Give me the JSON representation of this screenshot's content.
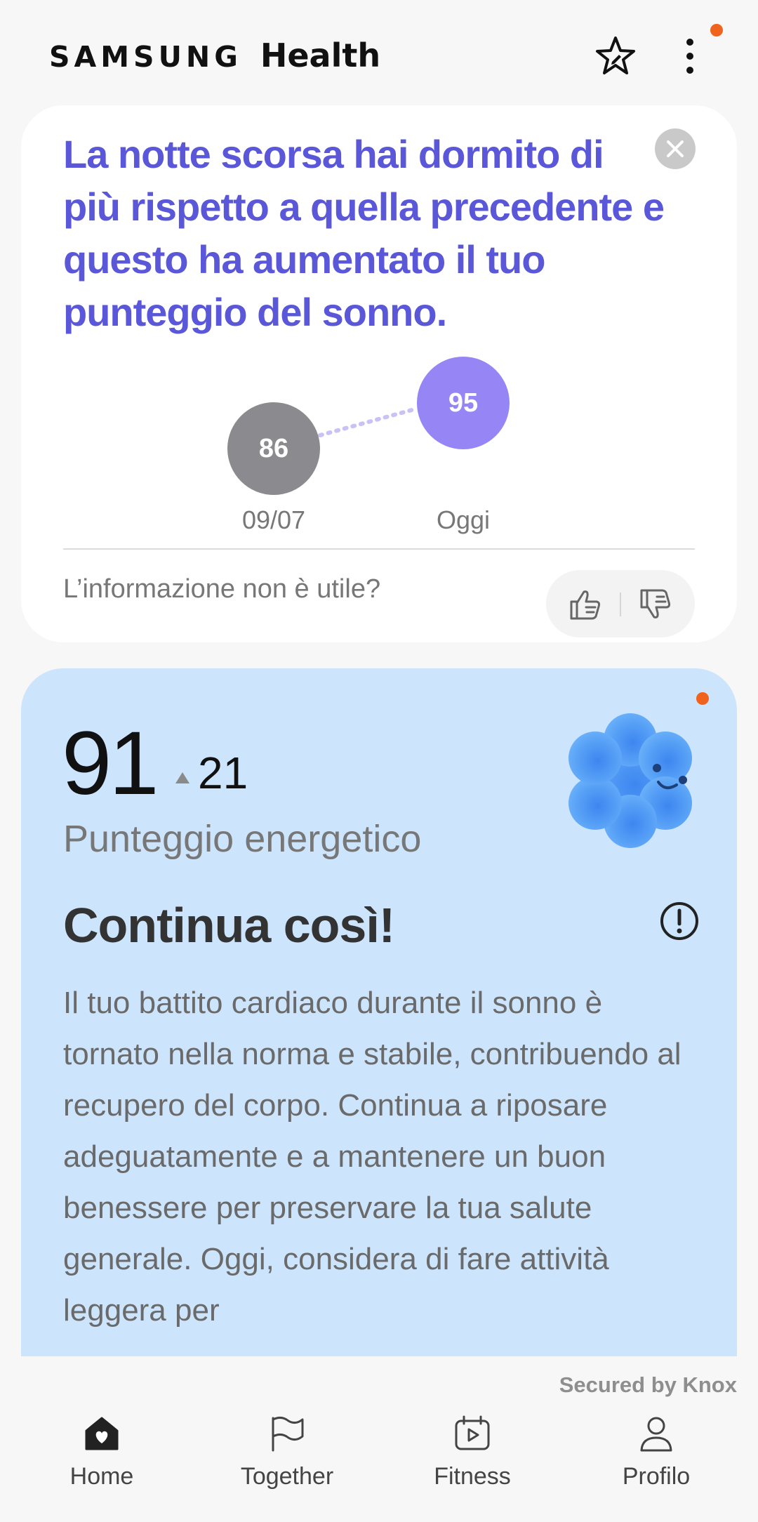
{
  "header": {
    "brand_samsung": "SAMSUNG",
    "brand_health": "Health",
    "star_icon": "star-edit-icon",
    "more_icon": "more-vertical-icon",
    "notification_dot_color": "#f0631c"
  },
  "sleep_card": {
    "title": "La notte scorsa hai dormito di più rispetto a quella precedente e questo ha aumentato il tuo punteggio del sonno.",
    "close_icon": "close-icon",
    "comparison": {
      "previous": {
        "date": "09/07",
        "score": "86"
      },
      "today": {
        "date": "Oggi",
        "score": "95"
      }
    },
    "feedback_question": "L’informazione non è utile?",
    "thumb_up_icon": "thumb-up-icon",
    "thumb_down_icon": "thumb-down-icon",
    "accent_color": "#5a57d8"
  },
  "energy_card": {
    "score": "91",
    "delta": "21",
    "delta_direction": "up",
    "score_label": "Punteggio energetico",
    "heading": "Continua così!",
    "info_icon": "info-icon",
    "mascot_icon": "blue-flower-mascot-icon",
    "body": "Il tuo battito cardiaco durante il sonno è tornato nella norma e stabile, contribuendo al recupero del corpo. Continua a riposare adeguatamente e a mantenere un buon benessere per preservare la tua salute generale. Oggi, considera di fare attività leggera per",
    "background_color": "#cde5fc"
  },
  "footer": {
    "knox": "Secured by Knox"
  },
  "nav": {
    "items": [
      {
        "label": "Home",
        "icon": "home-heart-icon"
      },
      {
        "label": "Together",
        "icon": "flag-icon"
      },
      {
        "label": "Fitness",
        "icon": "fitness-calendar-play-icon"
      },
      {
        "label": "Profilo",
        "icon": "person-icon"
      }
    ]
  }
}
